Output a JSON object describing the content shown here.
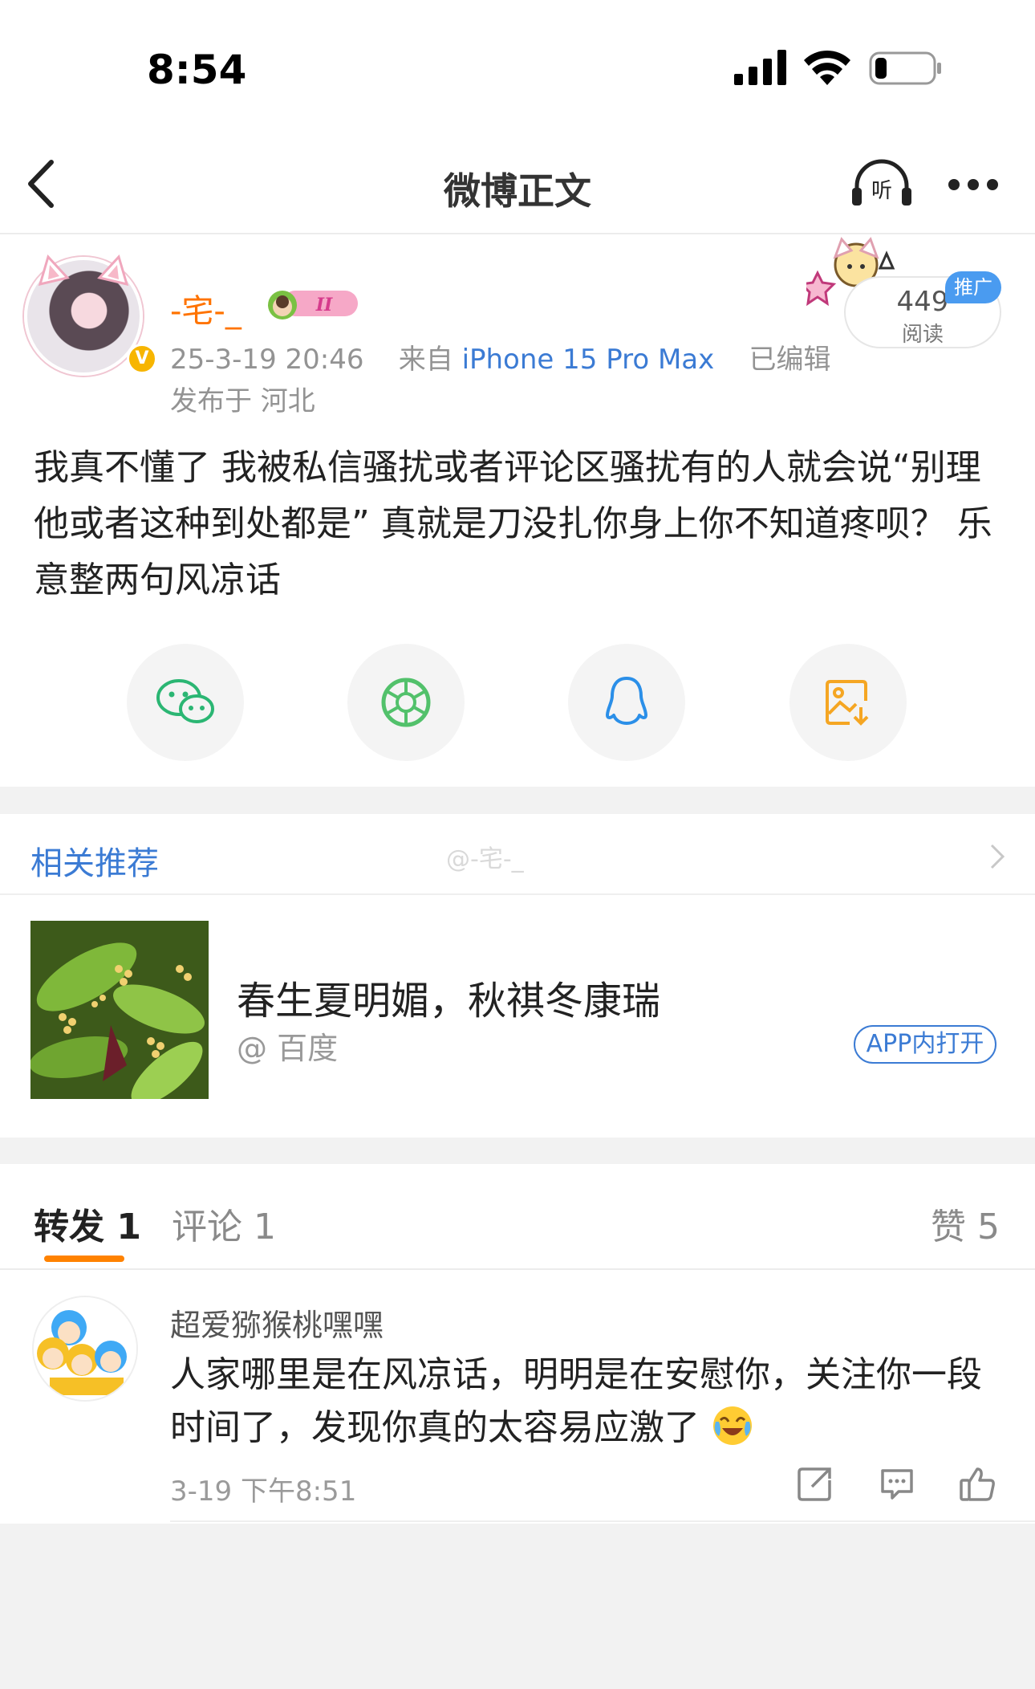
{
  "status_bar": {
    "time": "8:54"
  },
  "nav": {
    "title": "微博正文",
    "listen_label": "听"
  },
  "post": {
    "username": "-宅-_",
    "level": "II",
    "timestamp": "25-3-19 20:46",
    "from_prefix": "来自",
    "device": "iPhone 15 Pro Max",
    "edited": "已编辑",
    "location": "发布于 河北",
    "read_count": "449",
    "read_label": "阅读",
    "promo_tag": "推广",
    "body": "我真不懂了 我被私信骚扰或者评论区骚扰有的人就会说“别理他或者这种到处都是” 真就是刀没扎你身上你不知道疼呗？ 乐意整两句风凉话"
  },
  "share_buttons": [
    "wechat-icon",
    "moments-icon",
    "qq-icon",
    "save-image-icon"
  ],
  "related": {
    "title": "相关推荐",
    "watermark": "@-宅-_",
    "headline": "春生夏明媚，秋祺冬康瑞",
    "source": "@ 百度",
    "open_app": "APP内打开"
  },
  "tabs": {
    "repost": "转发 1",
    "comment": "评论 1",
    "like": "赞 5"
  },
  "comment": {
    "user": "超爱猕猴桃嘿嘿",
    "text": "人家哪里是在风凉话，明明是在安慰你，关注你一段时间了，发现你真的太容易应激了",
    "time": "3-19 下午8:51"
  },
  "colors": {
    "accent": "#ff8200",
    "link": "#3b7bd4",
    "username": "#ff7300",
    "verified": "#f7b500"
  }
}
